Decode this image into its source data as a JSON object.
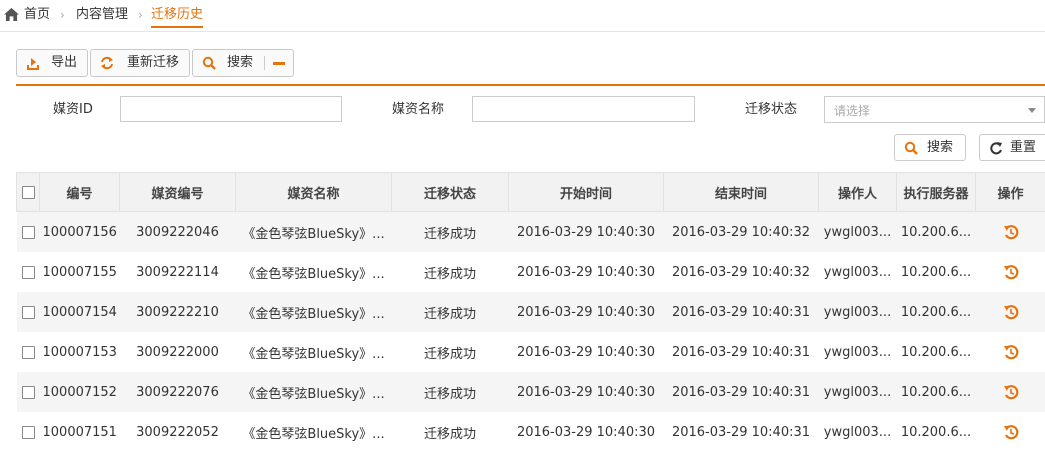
{
  "breadcrumb": {
    "home": "首页",
    "section": "内容管理",
    "current": "迁移历史"
  },
  "toolbar": {
    "export_label": "导出",
    "remigrate_label": "重新迁移",
    "search_label": "搜索"
  },
  "filters": {
    "media_id_label": "媒资ID",
    "media_id_value": "",
    "media_name_label": "媒资名称",
    "media_name_value": "",
    "status_label": "迁移状态",
    "status_placeholder": "请选择",
    "search_button": "搜索",
    "reset_button": "重置"
  },
  "table": {
    "columns": [
      "编号",
      "媒资编号",
      "媒资名称",
      "迁移状态",
      "开始时间",
      "结束时间",
      "操作人",
      "执行服务器",
      "操作"
    ],
    "rows": [
      {
        "id": "100007156",
        "media_no": "3009222046",
        "name": "《金色琴弦BlueSky》...",
        "status": "迁移成功",
        "start": "2016-03-29 10:40:30",
        "end": "2016-03-29 10:40:32",
        "operator": "ywgl003...",
        "server": "10.200.6..."
      },
      {
        "id": "100007155",
        "media_no": "3009222114",
        "name": "《金色琴弦BlueSky》...",
        "status": "迁移成功",
        "start": "2016-03-29 10:40:30",
        "end": "2016-03-29 10:40:32",
        "operator": "ywgl003...",
        "server": "10.200.6..."
      },
      {
        "id": "100007154",
        "media_no": "3009222210",
        "name": "《金色琴弦BlueSky》...",
        "status": "迁移成功",
        "start": "2016-03-29 10:40:30",
        "end": "2016-03-29 10:40:31",
        "operator": "ywgl003...",
        "server": "10.200.6..."
      },
      {
        "id": "100007153",
        "media_no": "3009222000",
        "name": "《金色琴弦BlueSky》...",
        "status": "迁移成功",
        "start": "2016-03-29 10:40:30",
        "end": "2016-03-29 10:40:31",
        "operator": "ywgl003...",
        "server": "10.200.6..."
      },
      {
        "id": "100007152",
        "media_no": "3009222076",
        "name": "《金色琴弦BlueSky》...",
        "status": "迁移成功",
        "start": "2016-03-29 10:40:30",
        "end": "2016-03-29 10:40:31",
        "operator": "ywgl003...",
        "server": "10.200.6..."
      },
      {
        "id": "100007151",
        "media_no": "3009222052",
        "name": "《金色琴弦BlueSky》...",
        "status": "迁移成功",
        "start": "2016-03-29 10:40:30",
        "end": "2016-03-29 10:40:31",
        "operator": "ywgl003...",
        "server": "10.200.6..."
      }
    ]
  },
  "colors": {
    "accent": "#e8720c",
    "success": "#2a8a2a",
    "header_bg": "#f2f2f2",
    "stripe_bg": "#f5f5f5"
  },
  "icons": {
    "home": "home-icon",
    "export": "export-icon",
    "remigrate": "refresh-icon",
    "search": "search-icon",
    "collapse": "minus-icon",
    "reset": "reset-icon",
    "row_action": "redo-icon"
  }
}
